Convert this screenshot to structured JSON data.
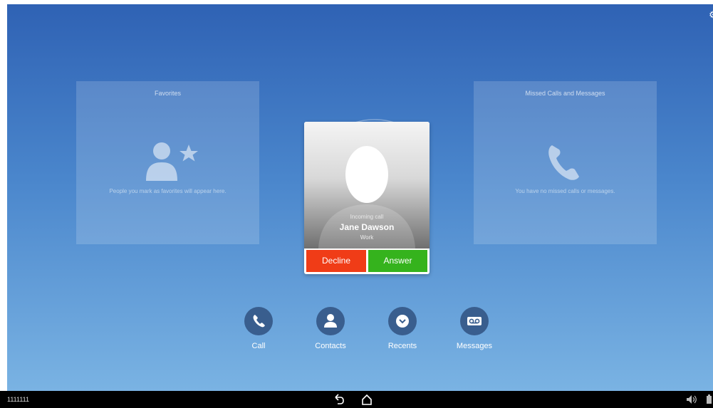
{
  "favorites": {
    "title": "Favorites",
    "empty_text": "People you mark as favorites will appear here."
  },
  "missed": {
    "title": "Missed Calls and Messages",
    "empty_text": "You have no missed calls or messages."
  },
  "incoming_call": {
    "label": "Incoming call",
    "caller_name": "Jane Dawson",
    "caller_type": "Work",
    "decline_label": "Decline",
    "answer_label": "Answer"
  },
  "bottom_nav": {
    "call_label": "Call",
    "contacts_label": "Contacts",
    "recents_label": "Recents",
    "messages_label": "Messages"
  },
  "status_bar": {
    "number": "1111111"
  },
  "icons": {
    "settings": "gear-icon",
    "favorites": "person-star-icon",
    "missed": "phone-icon",
    "call": "phone-icon",
    "contacts": "person-icon",
    "recents": "chevron-down-icon",
    "messages": "voicemail-icon",
    "back": "back-arrow-icon",
    "home": "home-icon",
    "volume": "volume-icon"
  },
  "colors": {
    "decline": "#f03c17",
    "answer": "#35b31d",
    "nav_circle": "#395e8e",
    "background_top": "#2f62b4",
    "background_bottom": "#7ab3e3"
  }
}
